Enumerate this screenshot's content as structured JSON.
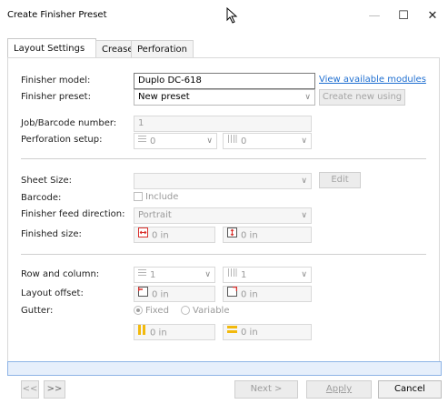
{
  "window": {
    "title": "Create Finisher Preset",
    "minimize": "—",
    "maximize": "☐",
    "close": "✕"
  },
  "tabs": [
    {
      "label": "Layout Settings",
      "active": true
    },
    {
      "label": "Crease",
      "active": false
    },
    {
      "label": "Perforation",
      "active": false
    }
  ],
  "form": {
    "finisher_model_label": "Finisher model:",
    "finisher_model_value": "Duplo DC-618",
    "view_modules_link": "View available modules",
    "finisher_preset_label": "Finisher preset:",
    "finisher_preset_value": "New preset",
    "create_new_using": "Create new using",
    "job_barcode_label": "Job/Barcode number:",
    "job_barcode_value": "1",
    "perforation_label": "Perforation setup:",
    "perforation_h_value": "0",
    "perforation_v_value": "0",
    "sheet_size_label": "Sheet Size:",
    "sheet_size_value": "",
    "edit_button": "Edit",
    "barcode_label": "Barcode:",
    "barcode_include": "Include",
    "feed_direction_label": "Finisher feed direction:",
    "feed_direction_value": "Portrait",
    "finished_size_label": "Finished size:",
    "finished_width": "0 in",
    "finished_height": "0 in",
    "row_column_label": "Row and column:",
    "rows_value": "1",
    "columns_value": "1",
    "layout_offset_label": "Layout offset:",
    "offset_x": "0 in",
    "offset_y": "0 in",
    "gutter_label": "Gutter:",
    "gutter_fixed": "Fixed",
    "gutter_variable": "Variable",
    "gutter_h": "0 in",
    "gutter_v": "0 in"
  },
  "footer": {
    "first": "<<",
    "prev": ">>",
    "next": "Next >",
    "apply": "Apply",
    "cancel": "Cancel"
  },
  "colors": {
    "accent_link": "#1f6fd1",
    "status_bar": "#e6effb",
    "icon_red": "#d9302c",
    "icon_yellow": "#f2b90c"
  }
}
